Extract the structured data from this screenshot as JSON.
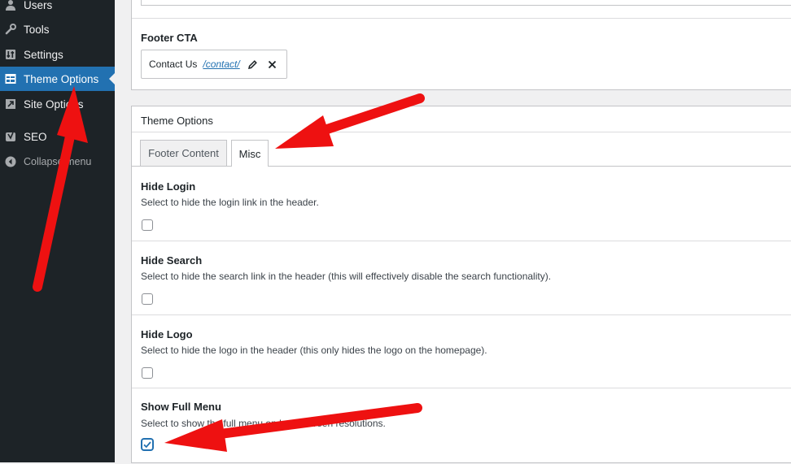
{
  "sidebar": {
    "items": [
      {
        "label": "Users",
        "icon": "users-icon"
      },
      {
        "label": "Tools",
        "icon": "wrench-icon"
      },
      {
        "label": "Settings",
        "icon": "settings-icon"
      },
      {
        "label": "Theme Options",
        "icon": "theme-options-icon",
        "active": true
      },
      {
        "label": "Site Options",
        "icon": "site-options-icon"
      },
      {
        "label": "SEO",
        "icon": "yoast-icon"
      },
      {
        "label": "Collapse menu",
        "icon": "collapse-icon"
      }
    ]
  },
  "footer_cta": {
    "title": "Footer CTA",
    "link_label": "Contact Us",
    "link_url": "/contact/"
  },
  "theme_options": {
    "title": "Theme Options",
    "tabs": [
      {
        "label": "Footer Content",
        "active": false
      },
      {
        "label": "Misc",
        "active": true
      }
    ],
    "fields": [
      {
        "title": "Hide Login",
        "desc": "Select to hide the login link in the header.",
        "checked": false
      },
      {
        "title": "Hide Search",
        "desc": "Select to hide the search link in the header (this will effectively disable the search functionality).",
        "checked": false
      },
      {
        "title": "Hide Logo",
        "desc": "Select to hide the logo in the header (this only hides the logo on the homepage).",
        "checked": false
      },
      {
        "title": "Show Full Menu",
        "desc": "Select to show the full menu on large screen resolutions.",
        "checked": true
      }
    ]
  },
  "colors": {
    "sidebar_bg": "#1d2327",
    "accent": "#2271b1",
    "annotation_arrow": "#ee1111"
  }
}
